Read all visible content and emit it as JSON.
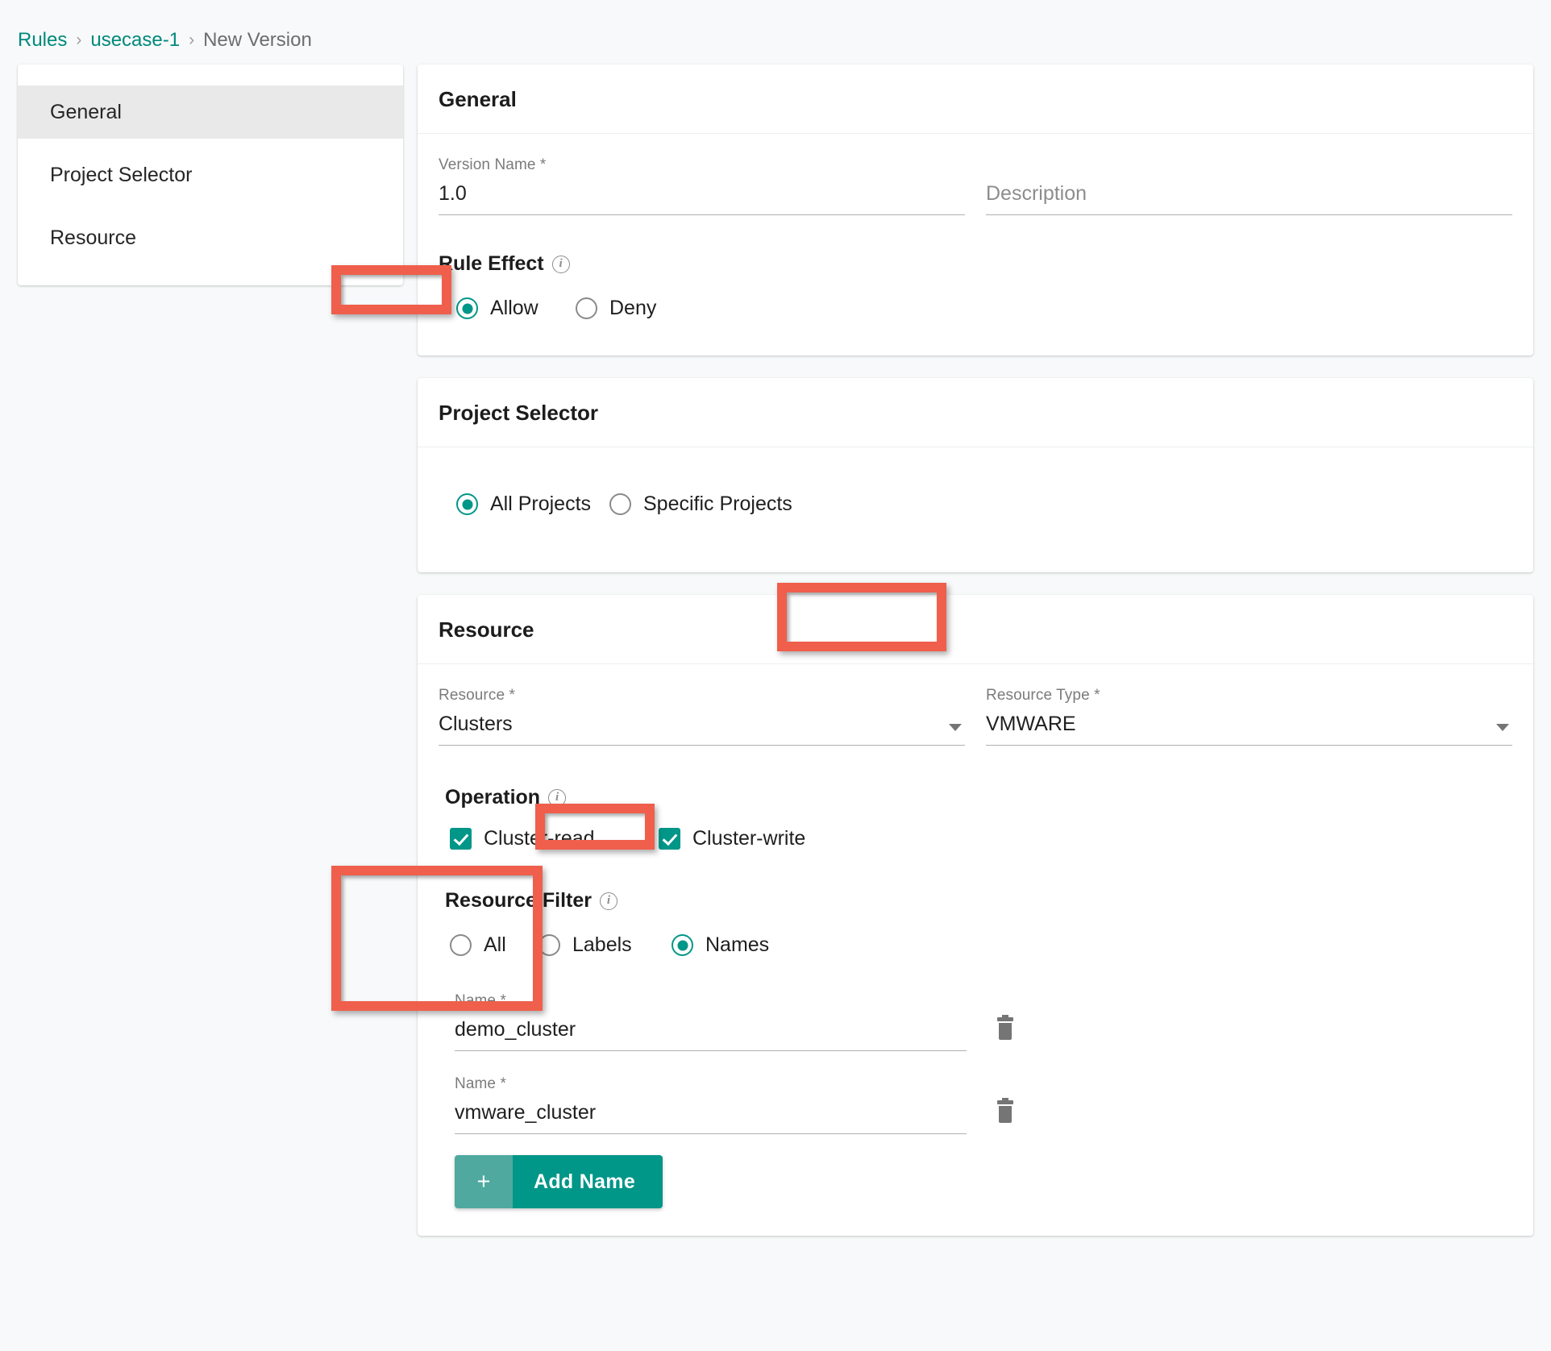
{
  "breadcrumb": {
    "items": [
      {
        "label": "Rules",
        "type": "link"
      },
      {
        "label": "usecase-1",
        "type": "link"
      },
      {
        "label": "New Version",
        "type": "current"
      }
    ],
    "separator": "›"
  },
  "sidebar": {
    "items": [
      {
        "label": "General",
        "active": true
      },
      {
        "label": "Project Selector",
        "active": false
      },
      {
        "label": "Resource",
        "active": false
      }
    ]
  },
  "general": {
    "title": "General",
    "version_name": {
      "label": "Version Name *",
      "value": "1.0"
    },
    "description": {
      "label": "Description",
      "value": "",
      "placeholder": "Description"
    },
    "rule_effect": {
      "label": "Rule Effect",
      "info_icon": "info-icon",
      "options": [
        {
          "label": "Allow",
          "selected": true
        },
        {
          "label": "Deny",
          "selected": false
        }
      ]
    }
  },
  "project_selector": {
    "title": "Project Selector",
    "options": [
      {
        "label": "All Projects",
        "selected": true
      },
      {
        "label": "Specific Projects",
        "selected": false
      }
    ]
  },
  "resource": {
    "title": "Resource",
    "resource": {
      "label": "Resource *",
      "value": "Clusters",
      "icon": "chevron-down-icon"
    },
    "resource_type": {
      "label": "Resource Type *",
      "value": "VMWARE",
      "icon": "chevron-down-icon"
    },
    "operation": {
      "label": "Operation",
      "info_icon": "info-icon",
      "items": [
        {
          "label": "Cluster-read",
          "checked": true
        },
        {
          "label": "Cluster-write",
          "checked": true
        }
      ]
    },
    "resource_filter": {
      "label": "Resource Filter",
      "info_icon": "info-icon",
      "options": [
        {
          "label": "All",
          "selected": false
        },
        {
          "label": "Labels",
          "selected": false
        },
        {
          "label": "Names",
          "selected": true
        }
      ]
    },
    "names": [
      {
        "label": "Name *",
        "value": "demo_cluster",
        "delete_icon": "trash-icon"
      },
      {
        "label": "Name *",
        "value": "vmware_cluster",
        "delete_icon": "trash-icon"
      }
    ],
    "add_name_button": {
      "plus": "+",
      "label": "Add Name"
    }
  },
  "colors": {
    "accent": "#009688",
    "accent_light": "#4fa99f",
    "annotation": "#ef5f4c",
    "link": "#00897b",
    "sidebar_active_bg": "#e9e9e9",
    "page_bg": "#f7f9fa"
  }
}
